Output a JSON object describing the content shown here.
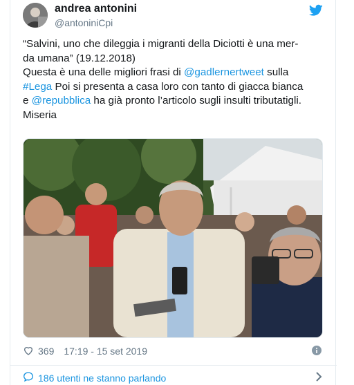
{
  "author": {
    "display_name": "andrea antonini",
    "handle": "@antoniniCpi"
  },
  "icons": {
    "brand": "twitter-bird-icon",
    "like": "heart-icon",
    "info": "info-icon",
    "conversation": "speech-bubble-icon",
    "chevron": "chevron-right-icon"
  },
  "colors": {
    "link": "#1b95e0",
    "muted": "#657786",
    "text": "#14171a",
    "border": "#e6ecf0"
  },
  "tweet": {
    "line1": "“Salvini, uno che dileggia i migranti della Diciotti è una mer-",
    "line2": "da umana” (19.12.2018)",
    "l3_prefix": "Questa è una delle migliori frasi di ",
    "mention1": "@gadlernertweet",
    "l3_suffix": " sulla",
    "hashtag": "#Lega",
    "l4_suffix": " Poi si presenta a casa loro con tanto di giacca bianca",
    "l5_prefix": "e ",
    "mention2": "@repubblica",
    "l5_suffix": " ha già pronto l’articolo sugli insulti tributatigli.",
    "line6": "Miseria"
  },
  "meta": {
    "likes": "369",
    "timestamp": "17:19 - 15 set 2019"
  },
  "footer": {
    "label": "186 utenti ne stanno parlando"
  }
}
